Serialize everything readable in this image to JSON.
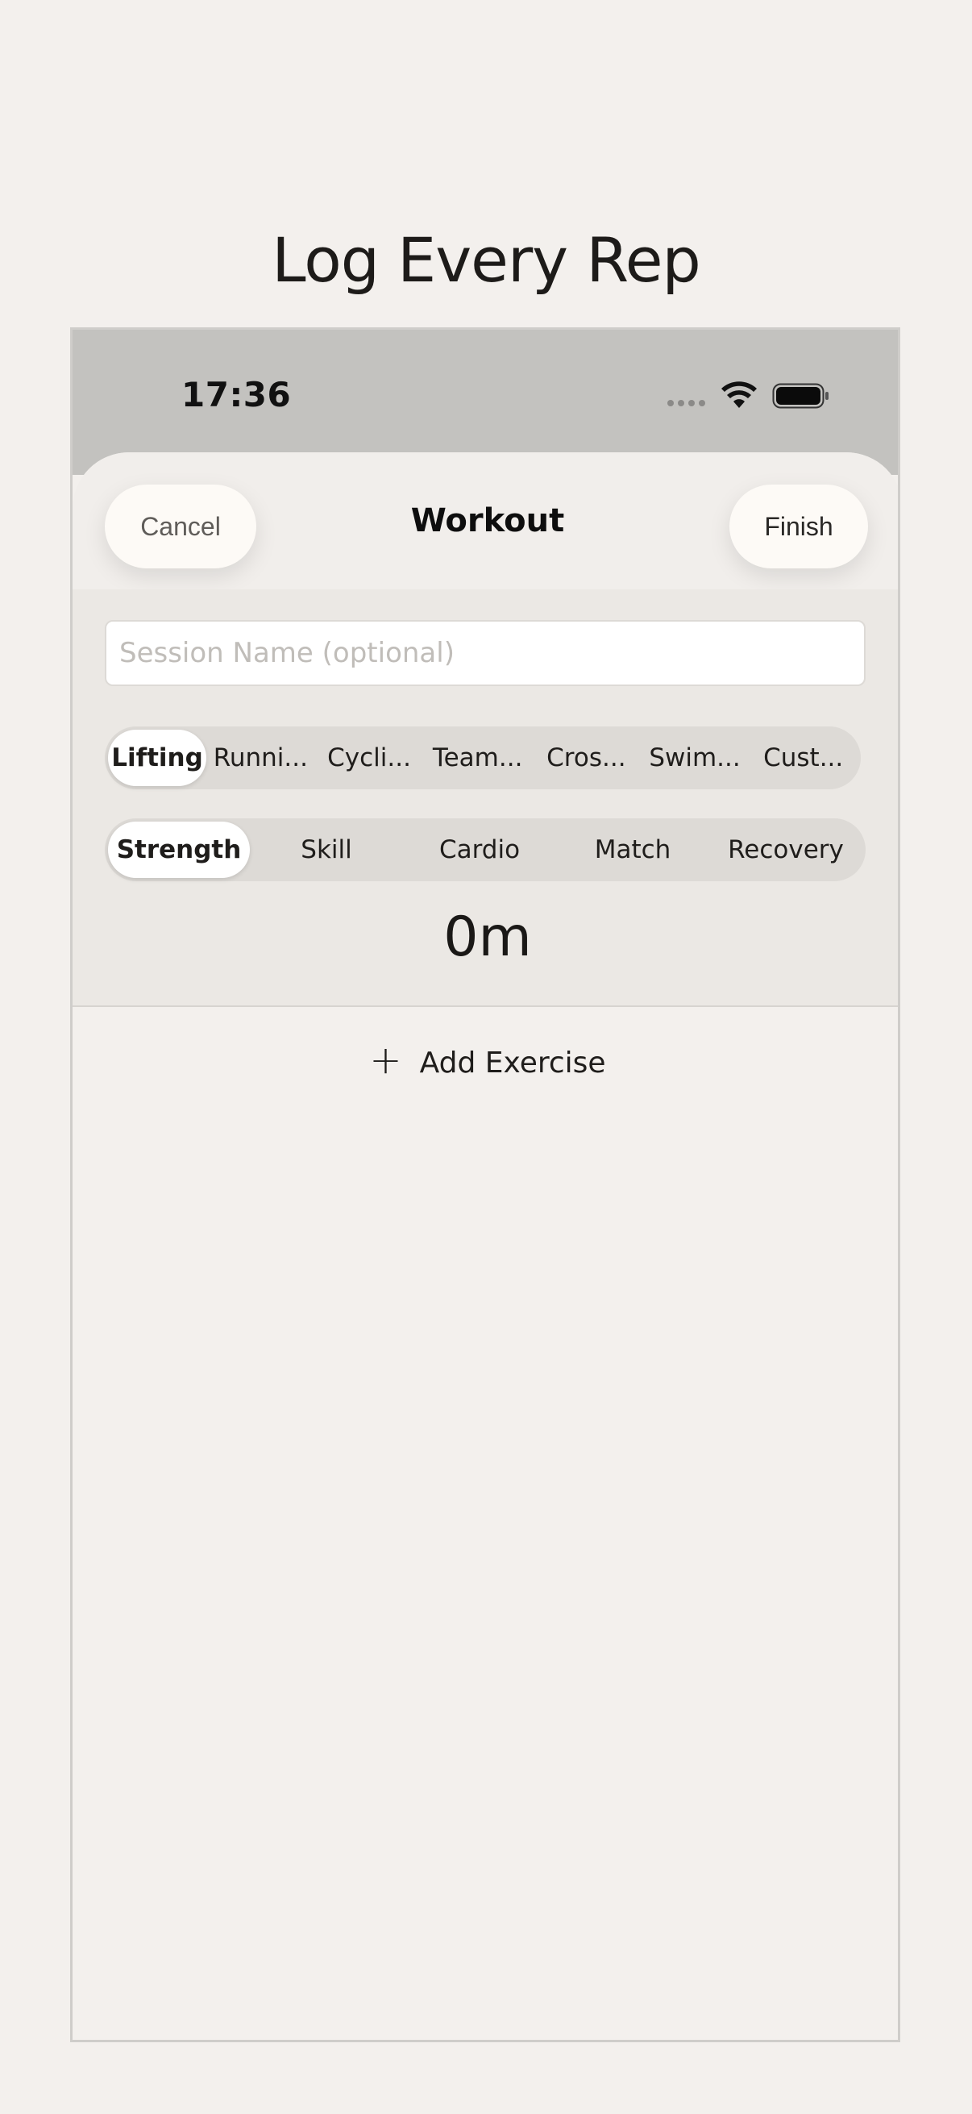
{
  "headline": "Log Every Rep",
  "status_bar": {
    "time": "17:36",
    "icons": [
      "cellular-signal-icon",
      "wifi-icon",
      "battery-icon"
    ]
  },
  "nav": {
    "cancel_label": "Cancel",
    "title": "Workout",
    "finish_label": "Finish"
  },
  "session_name": {
    "value": "",
    "placeholder": "Session Name (optional)"
  },
  "activity_types": {
    "selected": "Lifting",
    "items": [
      "Lifting",
      "Runni...",
      "Cycli...",
      "Team...",
      "Cros...",
      "Swim...",
      "Cust..."
    ]
  },
  "focus_types": {
    "selected": "Strength",
    "items": [
      "Strength",
      "Skill",
      "Cardio",
      "Match",
      "Recovery"
    ]
  },
  "duration": "0m",
  "add_exercise_label": "Add Exercise",
  "colors": {
    "background": "#f3f0ed",
    "status_bar": "#c3c2bf",
    "panel": "#ebe8e4",
    "segment_track": "#dddad6",
    "button_fill": "#fdfaf6"
  }
}
